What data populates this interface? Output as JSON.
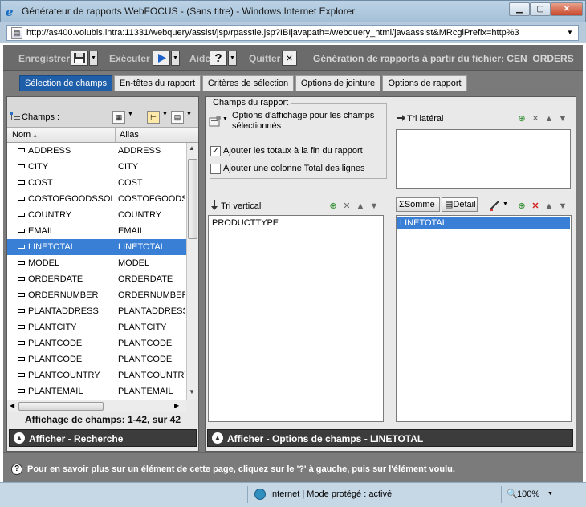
{
  "window": {
    "title": "Générateur de rapports WebFOCUS - (Sans titre) - Windows Internet Explorer",
    "url": "http://as400.volubis.intra:11331/webquery/assist/jsp/rpasstie.jsp?IBIjavapath=/webquery_html/javaassist&MRcgiPrefix=http%3"
  },
  "toolbar": {
    "save_label": "Enregistrer",
    "run_label": "Exécuter",
    "help_label": "Aide",
    "help_glyph": "?",
    "quit_label": "Quitter",
    "quit_glyph": "×",
    "subtitle": "Génération de rapports à partir du fichier: CEN_ORDERS"
  },
  "tabs": [
    {
      "label": "Sélection de champs",
      "active": true
    },
    {
      "label": "En-têtes du rapport",
      "active": false
    },
    {
      "label": "Critères de sélection",
      "active": false
    },
    {
      "label": "Options de jointure",
      "active": false
    },
    {
      "label": "Options de rapport",
      "active": false
    }
  ],
  "fields_panel": {
    "label": "Champs :",
    "col_name": "Nom",
    "col_alias": "Alias",
    "sort_glyph": "▲",
    "rows": [
      {
        "name": "ADDRESS",
        "alias": "ADDRESS",
        "selected": false
      },
      {
        "name": "CITY",
        "alias": "CITY",
        "selected": false
      },
      {
        "name": "COST",
        "alias": "COST",
        "selected": false
      },
      {
        "name": "COSTOFGOODSSOLD",
        "alias": "COSTOFGOODSS",
        "selected": false
      },
      {
        "name": "COUNTRY",
        "alias": "COUNTRY",
        "selected": false
      },
      {
        "name": "EMAIL",
        "alias": "EMAIL",
        "selected": false
      },
      {
        "name": "LINETOTAL",
        "alias": "LINETOTAL",
        "selected": true
      },
      {
        "name": "MODEL",
        "alias": "MODEL",
        "selected": false
      },
      {
        "name": "ORDERDATE",
        "alias": "ORDERDATE",
        "selected": false
      },
      {
        "name": "ORDERNUMBER",
        "alias": "ORDERNUMBER",
        "selected": false
      },
      {
        "name": "PLANTADDRESS",
        "alias": "PLANTADDRESS",
        "selected": false
      },
      {
        "name": "PLANTCITY",
        "alias": "PLANTCITY",
        "selected": false
      },
      {
        "name": "PLANTCODE",
        "alias": "PLANTCODE",
        "selected": false
      },
      {
        "name": "PLANTCODE",
        "alias": "PLANTCODE",
        "selected": false
      },
      {
        "name": "PLANTCOUNTRY",
        "alias": "PLANTCOUNTRY",
        "selected": false
      },
      {
        "name": "PLANTEMAIL",
        "alias": "PLANTEMAIL",
        "selected": false
      }
    ],
    "count_text": "Affichage de champs: 1-42, sur 42",
    "bottom_bar": "Afficher - Recherche"
  },
  "report_fields": {
    "group_label": "Champs du rapport",
    "display_options": "Options d'affichage pour les champs sélectionnés",
    "cb_totals": {
      "label": "Ajouter les totaux à la fin du rapport",
      "checked": true
    },
    "cb_linetotal": {
      "label": "Ajouter une colonne Total des lignes",
      "checked": false
    },
    "side_sort_label": "Tri latéral",
    "vertical_sort_label": "Tri vertical",
    "vertical_items": [
      "PRODUCTTYPE"
    ],
    "sum_label": "Somme",
    "detail_label": "Détail",
    "measure_items": [
      "LINETOTAL"
    ],
    "bottom_bar": "Afficher - Options de champs - LINETOTAL"
  },
  "help_text": "Pour en savoir plus sur un élément de cette page, cliquez sur le '?' à gauche, puis sur l'élément voulu.",
  "statusbar": {
    "zone": "Internet | Mode protégé : activé",
    "zoom": "100%"
  }
}
